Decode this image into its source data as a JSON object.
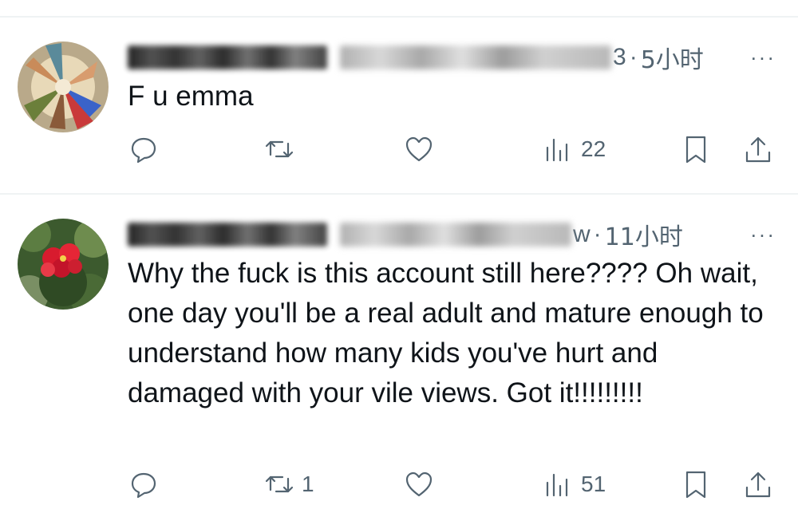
{
  "replies": [
    {
      "handle_tail": "3",
      "separator": "·",
      "time": "5小时",
      "more": "···",
      "text": "F u emma",
      "actions": {
        "reply_count": "",
        "retweet_count": "",
        "like_count": "",
        "views_count": "22"
      },
      "icons": [
        "reply-icon",
        "retweet-icon",
        "like-icon",
        "views-icon",
        "bookmark-icon",
        "share-icon"
      ]
    },
    {
      "handle_tail": "w",
      "separator": "·",
      "time": "11小时",
      "more": "···",
      "text": "Why the fuck is this account still here???? Oh wait, one day you'll be a real adult and mature enough to understand how many kids you've hurt and damaged with your vile views. Got it!!!!!!!!!",
      "actions": {
        "reply_count": "",
        "retweet_count": "1",
        "like_count": "",
        "views_count": "51"
      },
      "icons": [
        "reply-icon",
        "retweet-icon",
        "like-icon",
        "views-icon",
        "bookmark-icon",
        "share-icon"
      ]
    }
  ],
  "colors": {
    "text": "#0f1419",
    "secondary": "#536471",
    "divider": "#eff3f4"
  }
}
